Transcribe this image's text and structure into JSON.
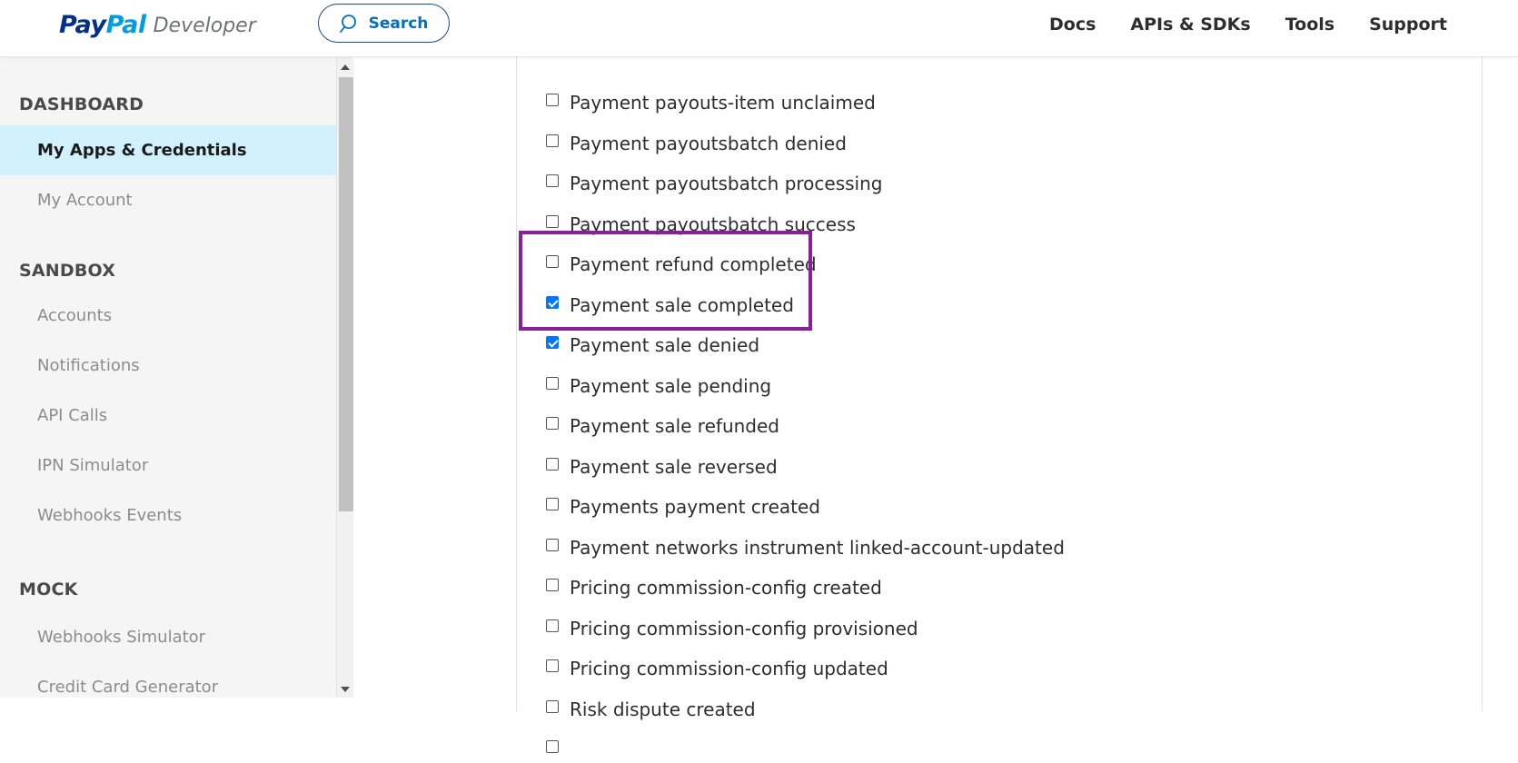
{
  "header": {
    "logo_pay": "Pay",
    "logo_pal": "Pal",
    "logo_dev": "Developer",
    "search_label": "Search",
    "search_icon": "search-icon",
    "nav": [
      "Docs",
      "APIs & SDKs",
      "Tools",
      "Support"
    ]
  },
  "sidebar": {
    "sections": [
      {
        "title": "DASHBOARD"
      },
      {
        "title": "SANDBOX"
      },
      {
        "title": "MOCK"
      }
    ],
    "items": [
      {
        "label": "My Apps & Credentials",
        "active": true
      },
      {
        "label": "My Account"
      },
      {
        "label": "Accounts"
      },
      {
        "label": "Notifications"
      },
      {
        "label": "API Calls"
      },
      {
        "label": "IPN Simulator"
      },
      {
        "label": "Webhooks Events"
      },
      {
        "label": "Webhooks Simulator"
      },
      {
        "label": "Credit Card Generator"
      }
    ],
    "active_bg": "#d1f1ff"
  },
  "events": [
    {
      "label": "Payment payouts-item unclaimed",
      "checked": false
    },
    {
      "label": "Payment payoutsbatch denied",
      "checked": false
    },
    {
      "label": "Payment payoutsbatch processing",
      "checked": false
    },
    {
      "label": "Payment payoutsbatch success",
      "checked": false
    },
    {
      "label": "Payment refund completed",
      "checked": false
    },
    {
      "label": "Payment sale completed",
      "checked": true
    },
    {
      "label": "Payment sale denied",
      "checked": true
    },
    {
      "label": "Payment sale pending",
      "checked": false
    },
    {
      "label": "Payment sale refunded",
      "checked": false
    },
    {
      "label": "Payment sale reversed",
      "checked": false
    },
    {
      "label": "Payments payment created",
      "checked": false
    },
    {
      "label": "Payment networks instrument linked-account-updated",
      "checked": false
    },
    {
      "label": "Pricing commission-config created",
      "checked": false
    },
    {
      "label": "Pricing commission-config provisioned",
      "checked": false
    },
    {
      "label": "Pricing commission-config updated",
      "checked": false
    },
    {
      "label": "Risk dispute created",
      "checked": false
    },
    {
      "label": "",
      "checked": false
    }
  ],
  "colors": {
    "brand_dark": "#003087",
    "brand_light": "#009cde",
    "checkbox_checked": "#0075ff",
    "highlight": "#8b1f9b"
  }
}
